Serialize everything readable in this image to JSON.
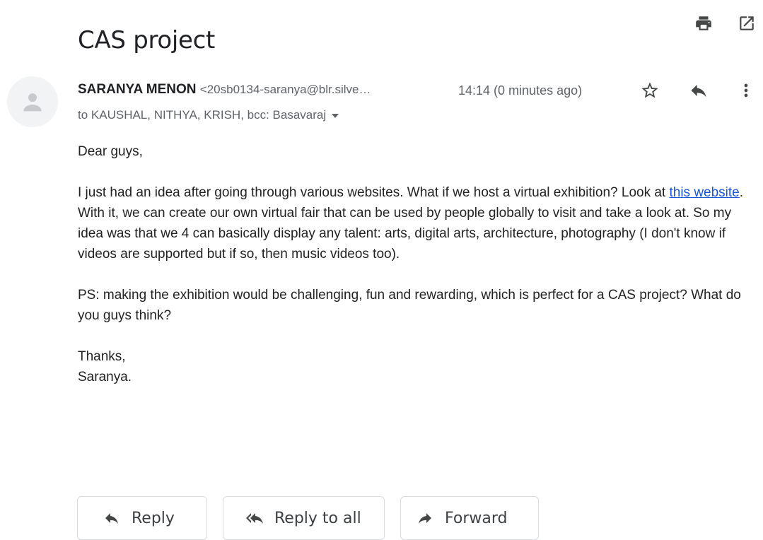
{
  "email": {
    "subject": "CAS project",
    "sender": {
      "name": "SARANYA MENON",
      "email": "<20sb0134-saranya@blr.silve…"
    },
    "time": "14:14 (0 minutes ago)",
    "recipients": "to KAUSHAL, NITHYA, KRISH, bcc: Basavaraj",
    "body": {
      "greeting": "Dear guys,",
      "p1_before_link": "I just had an idea after going through various websites. What if we host a virtual exhibition? Look at ",
      "link_text": "this website",
      "p1_after_link": ". With it, we can create our own virtual fair that can be used by people globally to visit and take a look at. So my idea was that we 4 can basically display any talent: arts, digital arts, architecture, photography (I don't know if videos are supported but if so, then music videos too).",
      "p2": "PS: making the exhibition would be challenging, fun and rewarding, which is perfect for a CAS project? What do you guys think?",
      "closing": "Thanks,",
      "signature": "Saranya."
    }
  },
  "actions": {
    "reply": "Reply",
    "reply_all": "Reply to all",
    "forward": "Forward"
  },
  "icons": {
    "print": "print-icon",
    "popout": "open-in-new-window-icon",
    "star": "star-outline-icon",
    "reply": "reply-icon",
    "more": "more-vertical-icon",
    "avatar": "person-placeholder-icon"
  },
  "colors": {
    "link": "#1a55d6",
    "text": "#222222",
    "secondary_text": "#5f6368",
    "button_border": "#dadce0"
  }
}
